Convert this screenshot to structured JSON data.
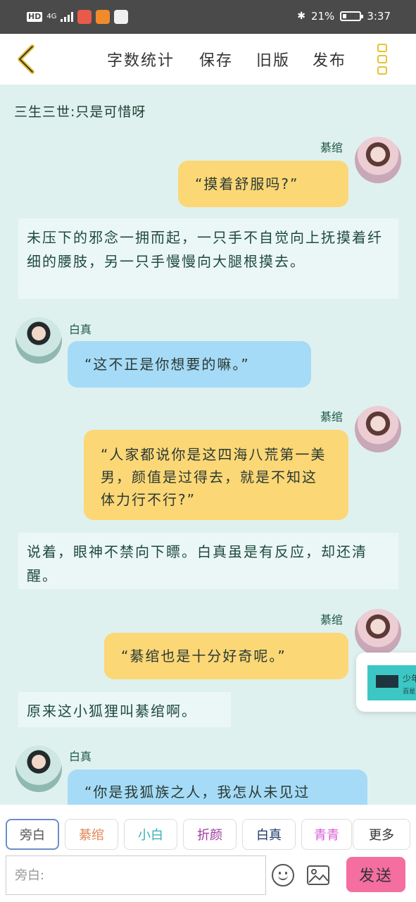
{
  "status_bar": {
    "hd": "HD",
    "network": "4G",
    "battery_text": "21%",
    "battery_level": 0.21,
    "time": "3:37"
  },
  "nav": {
    "back_icon": "chevron-left-icon",
    "word_count": "字数统计",
    "save": "保存",
    "old_version": "旧版",
    "publish": "发布",
    "more_icon": "more-icon"
  },
  "chat": {
    "title": "三生三世:只是可惜呀",
    "messages": [
      {
        "type": "dialog",
        "speaker": "綦绾",
        "side": "right",
        "color": "yellow",
        "text": "“摸着舒服吗?”"
      },
      {
        "type": "narration",
        "text": "未压下的邪念一拥而起，一只手不自觉向上抚摸着纤细的腰肢，另一只手慢慢向大腿根摸去。"
      },
      {
        "type": "dialog",
        "speaker": "白真",
        "side": "left",
        "color": "blue",
        "text": "“这不正是你想要的嘛。”"
      },
      {
        "type": "dialog",
        "speaker": "綦绾",
        "side": "right",
        "color": "yellow",
        "text": "“人家都说你是这四海八荒第一美男，颜值是过得去，就是不知这体力行不行?”"
      },
      {
        "type": "narration",
        "text": "说着，眼神不禁向下瞟。白真虽是有反应，却还清醒。"
      },
      {
        "type": "dialog",
        "speaker": "綦绾",
        "side": "right",
        "color": "yellow",
        "text": "“綦绾也是十分好奇呢。”"
      },
      {
        "type": "narration",
        "text": "原来这小狐狸叫綦绾啊。"
      },
      {
        "type": "dialog",
        "speaker": "白真",
        "side": "left",
        "color": "blue",
        "text": "“你是我狐族之人，我怎从未见过"
      }
    ]
  },
  "float_card": {
    "line1": "少年",
    "line2": "百是"
  },
  "roles": [
    {
      "label": "旁白",
      "color": "#555555"
    },
    {
      "label": "綦绾",
      "color": "#e38a5a"
    },
    {
      "label": "小白",
      "color": "#3ab0c0"
    },
    {
      "label": "折颜",
      "color": "#9c3aa0"
    },
    {
      "label": "白真",
      "color": "#1e3a6a"
    },
    {
      "label": "青青",
      "color": "#d85bd8"
    },
    {
      "label": "更多",
      "color": "#333333"
    }
  ],
  "composer": {
    "placeholder": "旁白:",
    "emoji_icon": "emoji-icon",
    "image_icon": "image-icon",
    "send": "发送"
  }
}
